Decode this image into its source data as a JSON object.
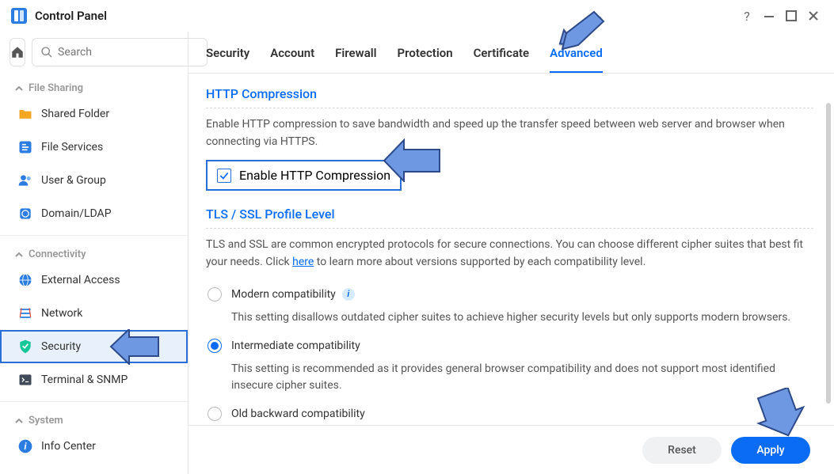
{
  "window": {
    "title": "Control Panel"
  },
  "search": {
    "placeholder": "Search"
  },
  "sidebar": {
    "sections": [
      {
        "label": "File Sharing",
        "items": [
          "Shared Folder",
          "File Services",
          "User & Group",
          "Domain/LDAP"
        ]
      },
      {
        "label": "Connectivity",
        "items": [
          "External Access",
          "Network",
          "Security",
          "Terminal & SNMP"
        ]
      },
      {
        "label": "System",
        "items": [
          "Info Center"
        ]
      }
    ]
  },
  "tabs": [
    "Security",
    "Account",
    "Firewall",
    "Protection",
    "Certificate",
    "Advanced"
  ],
  "http_compression": {
    "title": "HTTP Compression",
    "desc": "Enable HTTP compression to save bandwidth and speed up the transfer speed between web server and browser when connecting via HTTPS.",
    "checkbox_label": "Enable HTTP Compression",
    "checked": true
  },
  "tls": {
    "title": "TLS / SSL Profile Level",
    "desc_pre": "TLS and SSL are common encrypted protocols for secure connections. You can choose different cipher suites that best fit your needs. Click ",
    "desc_link": "here",
    "desc_post": " to learn more about versions supported by each compatibility level.",
    "options": [
      {
        "label": "Modern compatibility",
        "info": true,
        "desc": "This setting disallows outdated cipher suites to achieve higher security levels but only supports modern browsers."
      },
      {
        "label": "Intermediate compatibility",
        "desc": "This setting is recommended as it provides general browser compatibility and does not support most identified insecure cipher suites."
      },
      {
        "label": "Old backward compatibility"
      }
    ],
    "selected": 1
  },
  "footer": {
    "reset": "Reset",
    "apply": "Apply"
  }
}
